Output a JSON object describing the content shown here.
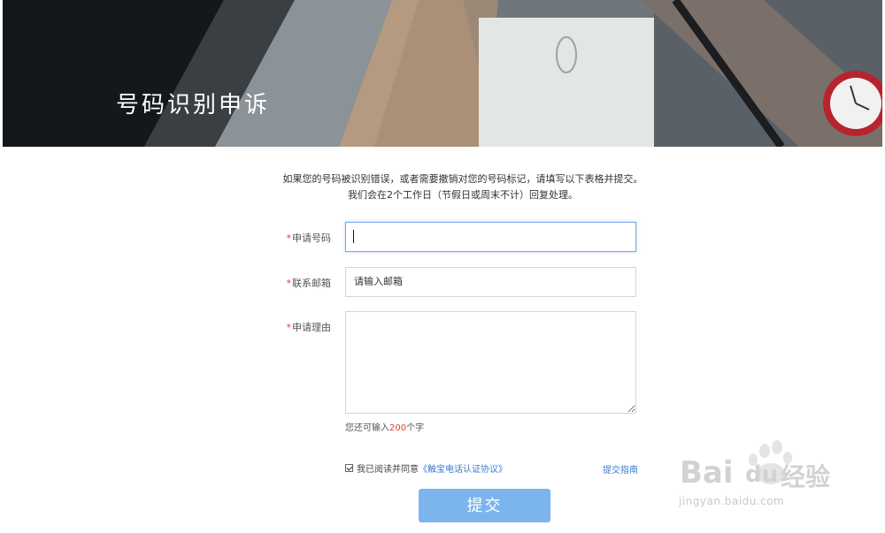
{
  "banner": {
    "title": "号码识别申诉"
  },
  "intro": {
    "line1": "如果您的号码被识别错误，或者需要撤销对您的号码标记，请填写以下表格并提交。",
    "line2": "我们会在2个工作日（节假日或周末不计）回复处理。"
  },
  "form": {
    "required_mark": "*",
    "phone": {
      "label": "申请号码",
      "value": ""
    },
    "email": {
      "label": "联系邮箱",
      "placeholder": "请输入邮箱"
    },
    "reason": {
      "label": "申请理由",
      "value": ""
    },
    "counter": {
      "prefix": "您还可输入",
      "remaining": "200",
      "suffix": "个字"
    }
  },
  "agreement": {
    "checked": true,
    "text": "我已阅读并同意",
    "link": "《触宝电话认证协议》"
  },
  "guide_link": "提交指南",
  "submit_label": "提交",
  "watermark": {
    "brand_left": "Bai",
    "brand_right": "du",
    "brand_cn": "经验",
    "url": "jingyan.baidu.com"
  },
  "colors": {
    "accent": "#3a7bd5",
    "submit_bg": "#7cb4ee",
    "required": "#e53935"
  }
}
